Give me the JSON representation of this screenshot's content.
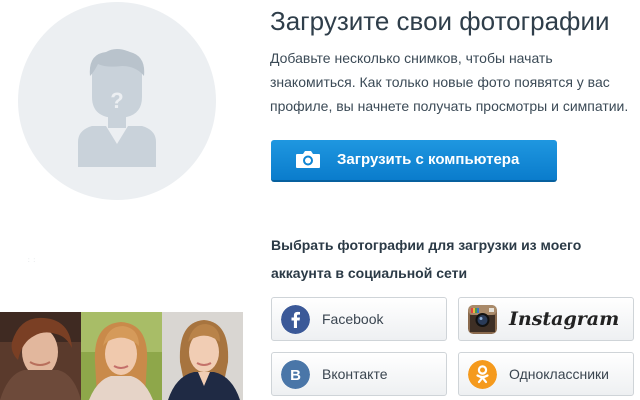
{
  "page": {
    "title": "Загрузите свои фотографии",
    "description_lines": [
      "Добавьте несколько снимков, чтобы начать",
      "знакомиться. Как только новые фото появятся у вас",
      "профиле, вы начнете получать просмотры и симпатии."
    ]
  },
  "upload": {
    "label": "Загрузить с компьютера",
    "icon": "camera-icon"
  },
  "social": {
    "heading_lines": [
      "Выбрать фотографии для загрузки из моего",
      "аккаунта в социальной сети"
    ],
    "buttons": [
      {
        "label": "Facebook",
        "icon": "facebook-icon"
      },
      {
        "label": "Instagram",
        "icon": "instagram-icon"
      },
      {
        "label": "Вконтакте",
        "icon": "vkontakte-icon"
      },
      {
        "label": "Одноклассники",
        "icon": "odnoklassniki-icon"
      }
    ]
  },
  "colors": {
    "primary_button": "#0a7ccc",
    "facebook": "#3b5998",
    "vkontakte": "#4a76a8",
    "odnoklassniki": "#f59a1d",
    "avatar_bg": "#eceff2",
    "placeholder_figure": "#c9d2da"
  }
}
